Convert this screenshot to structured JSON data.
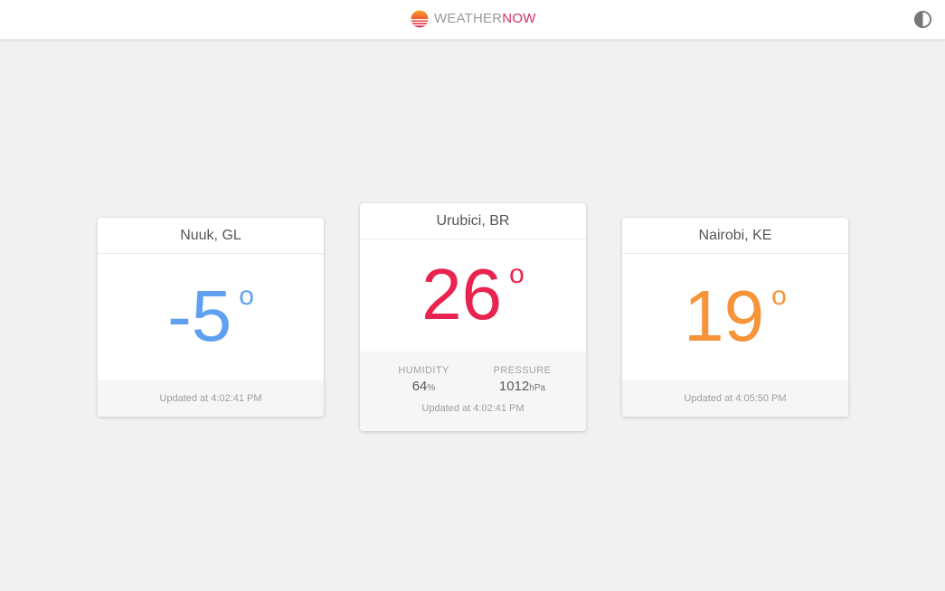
{
  "app": {
    "brand_weather": "WEATHER",
    "brand_now": "NOW",
    "logo_icon": "sun-stripes-icon",
    "theme_icon": "contrast-toggle-icon"
  },
  "colors": {
    "cold": "#60a0f0",
    "hot": "#e8234f",
    "warm": "#f7943a",
    "brand_accent": "#d62d67"
  },
  "cards": [
    {
      "city": "Nuuk, GL",
      "temperature": "-5",
      "degree_symbol": "o",
      "updated": "Updated at 4:02:41 PM"
    },
    {
      "city": "Urubici, BR",
      "temperature": "26",
      "degree_symbol": "o",
      "humidity_label": "HUMIDITY",
      "humidity_value": "64",
      "humidity_unit": "%",
      "pressure_label": "PRESSURE",
      "pressure_value": "1012",
      "pressure_unit": "hPa",
      "updated": "Updated at 4:02:41 PM"
    },
    {
      "city": "Nairobi, KE",
      "temperature": "19",
      "degree_symbol": "o",
      "updated": "Updated at 4:05:50 PM"
    }
  ]
}
